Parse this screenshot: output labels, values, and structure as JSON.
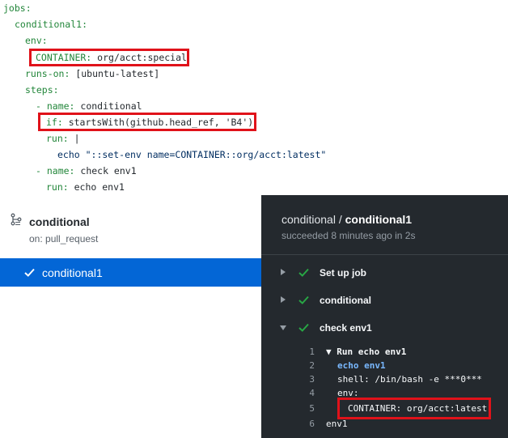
{
  "yaml": {
    "lines": [
      {
        "key": "jobs:",
        "val": ""
      },
      {
        "key": "conditional1:",
        "val": ""
      },
      {
        "key": "env:",
        "val": ""
      },
      {
        "key": "CONTAINER:",
        "val": " org/acct:special"
      },
      {
        "key": "runs-on:",
        "val": " [ubuntu-latest]"
      },
      {
        "key": "steps:",
        "val": ""
      },
      {
        "key": "- name:",
        "val": " conditional"
      },
      {
        "key": "if:",
        "val": " startsWith(github.head_ref, 'B4')"
      },
      {
        "key": "run:",
        "val": " |"
      },
      {
        "key": "",
        "val": "echo \"::set-env name=CONTAINER::org/acct:latest\""
      },
      {
        "key": "- name:",
        "val": " check env1"
      },
      {
        "key": "run:",
        "val": " echo env1"
      }
    ]
  },
  "workflow": {
    "title": "conditional",
    "trigger": "on: pull_request",
    "job_label": "conditional1"
  },
  "log_panel": {
    "title_prefix": "conditional / ",
    "title_job": "conditional1",
    "subtitle": "succeeded 8 minutes ago in 2s",
    "steps": [
      {
        "label": "Set up job",
        "expanded": false
      },
      {
        "label": "conditional",
        "expanded": false
      },
      {
        "label": "check env1",
        "expanded": true
      }
    ],
    "log_lines": [
      {
        "num": "1",
        "text": "▼ Run echo env1"
      },
      {
        "num": "2",
        "text": "echo env1"
      },
      {
        "num": "3",
        "text": "shell: /bin/bash -e ***0***"
      },
      {
        "num": "4",
        "text": "env:"
      },
      {
        "num": "5",
        "text": "CONTAINER: org/acct:latest"
      },
      {
        "num": "6",
        "text": "env1"
      }
    ]
  },
  "colors": {
    "highlight_border": "#e0121a",
    "selected_job_bg": "#0366d6",
    "success_check": "#28a745",
    "dark_panel_bg": "#24292e"
  }
}
